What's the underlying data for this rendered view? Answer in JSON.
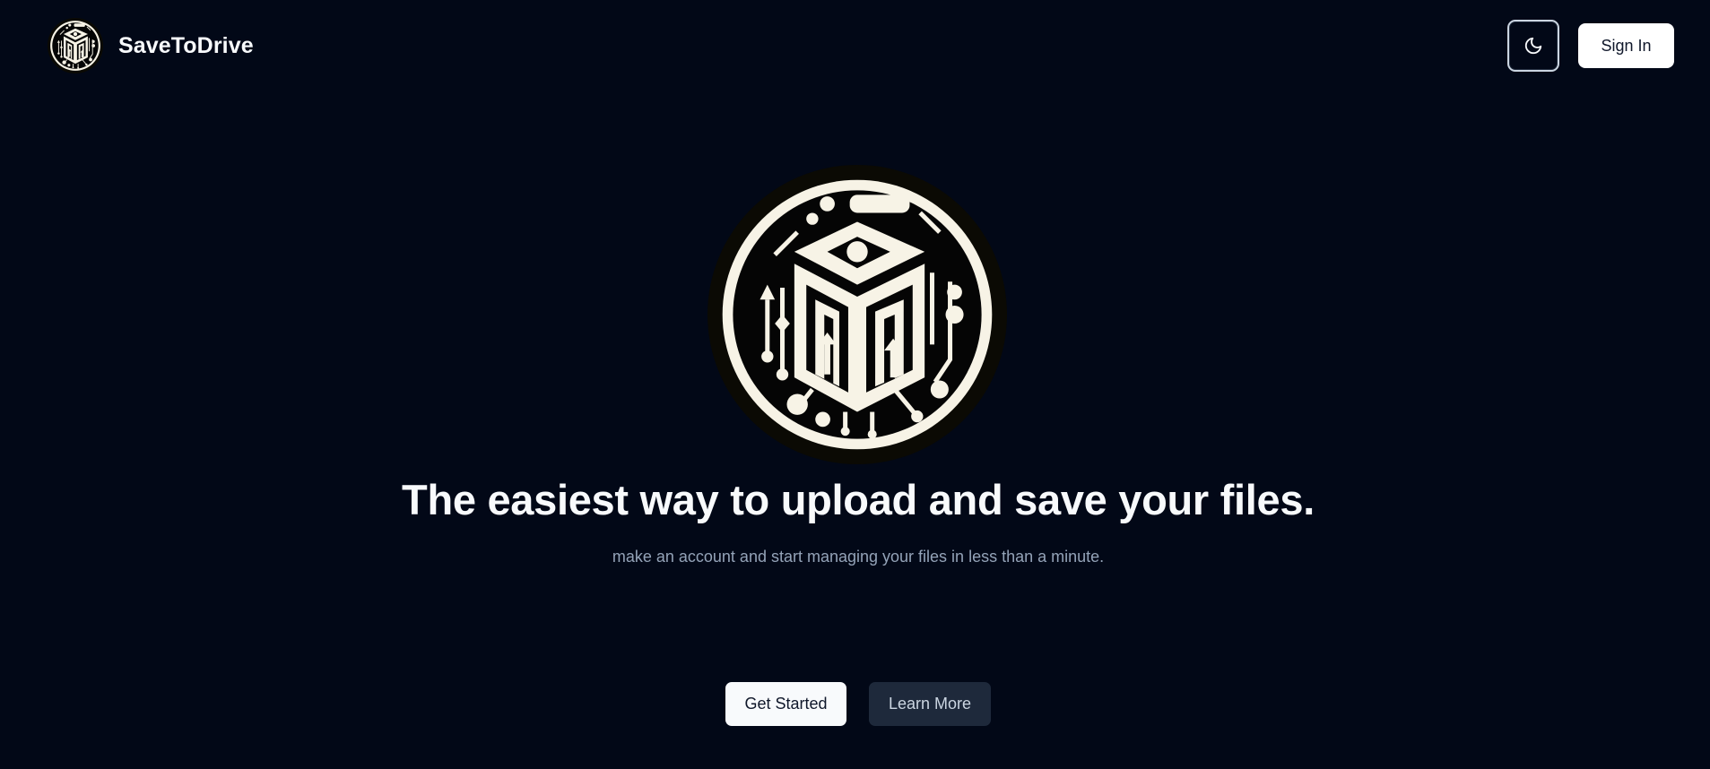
{
  "header": {
    "brand_name": "SaveToDrive",
    "theme_toggle_icon": "moon-icon",
    "signin_label": "Sign In"
  },
  "hero": {
    "logo_icon": "circuit-box-logo",
    "headline": "The easiest way to upload and save your files.",
    "subline": "make an account and start managing your files in less than a minute.",
    "primary_cta": "Get Started",
    "secondary_cta": "Learn More"
  },
  "colors": {
    "background": "#020817",
    "foreground": "#f8fafc",
    "muted": "#94a3b8",
    "secondary_bg": "#1e293b"
  }
}
